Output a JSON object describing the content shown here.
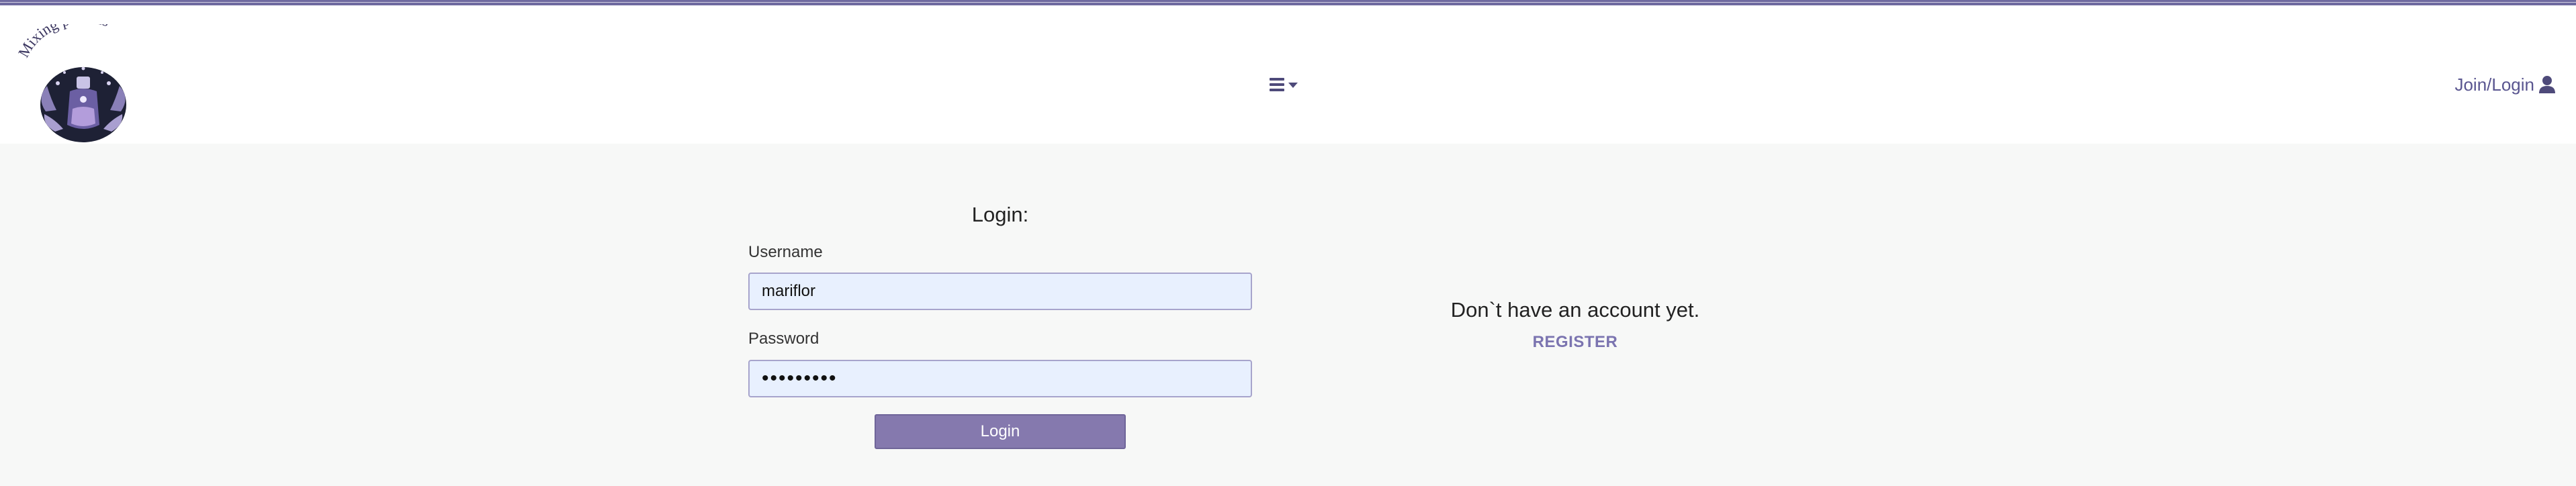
{
  "brand": {
    "name": "Mixing potions",
    "colors": {
      "accent": "#6f6aa0",
      "button": "#8579ae",
      "link": "#7b74b0",
      "input_bg": "#e8f0fe"
    }
  },
  "header": {
    "menu_icon": "hamburger-menu-icon",
    "join_login_label": "Join/Login",
    "user_icon": "user-icon"
  },
  "login": {
    "title": "Login:",
    "username_label": "Username",
    "username_value": "mariflor",
    "password_label": "Password",
    "password_value": "•••••••••",
    "submit_label": "Login"
  },
  "register": {
    "prompt": "Don`t have an account yet.",
    "link_label": "REGISTER"
  }
}
